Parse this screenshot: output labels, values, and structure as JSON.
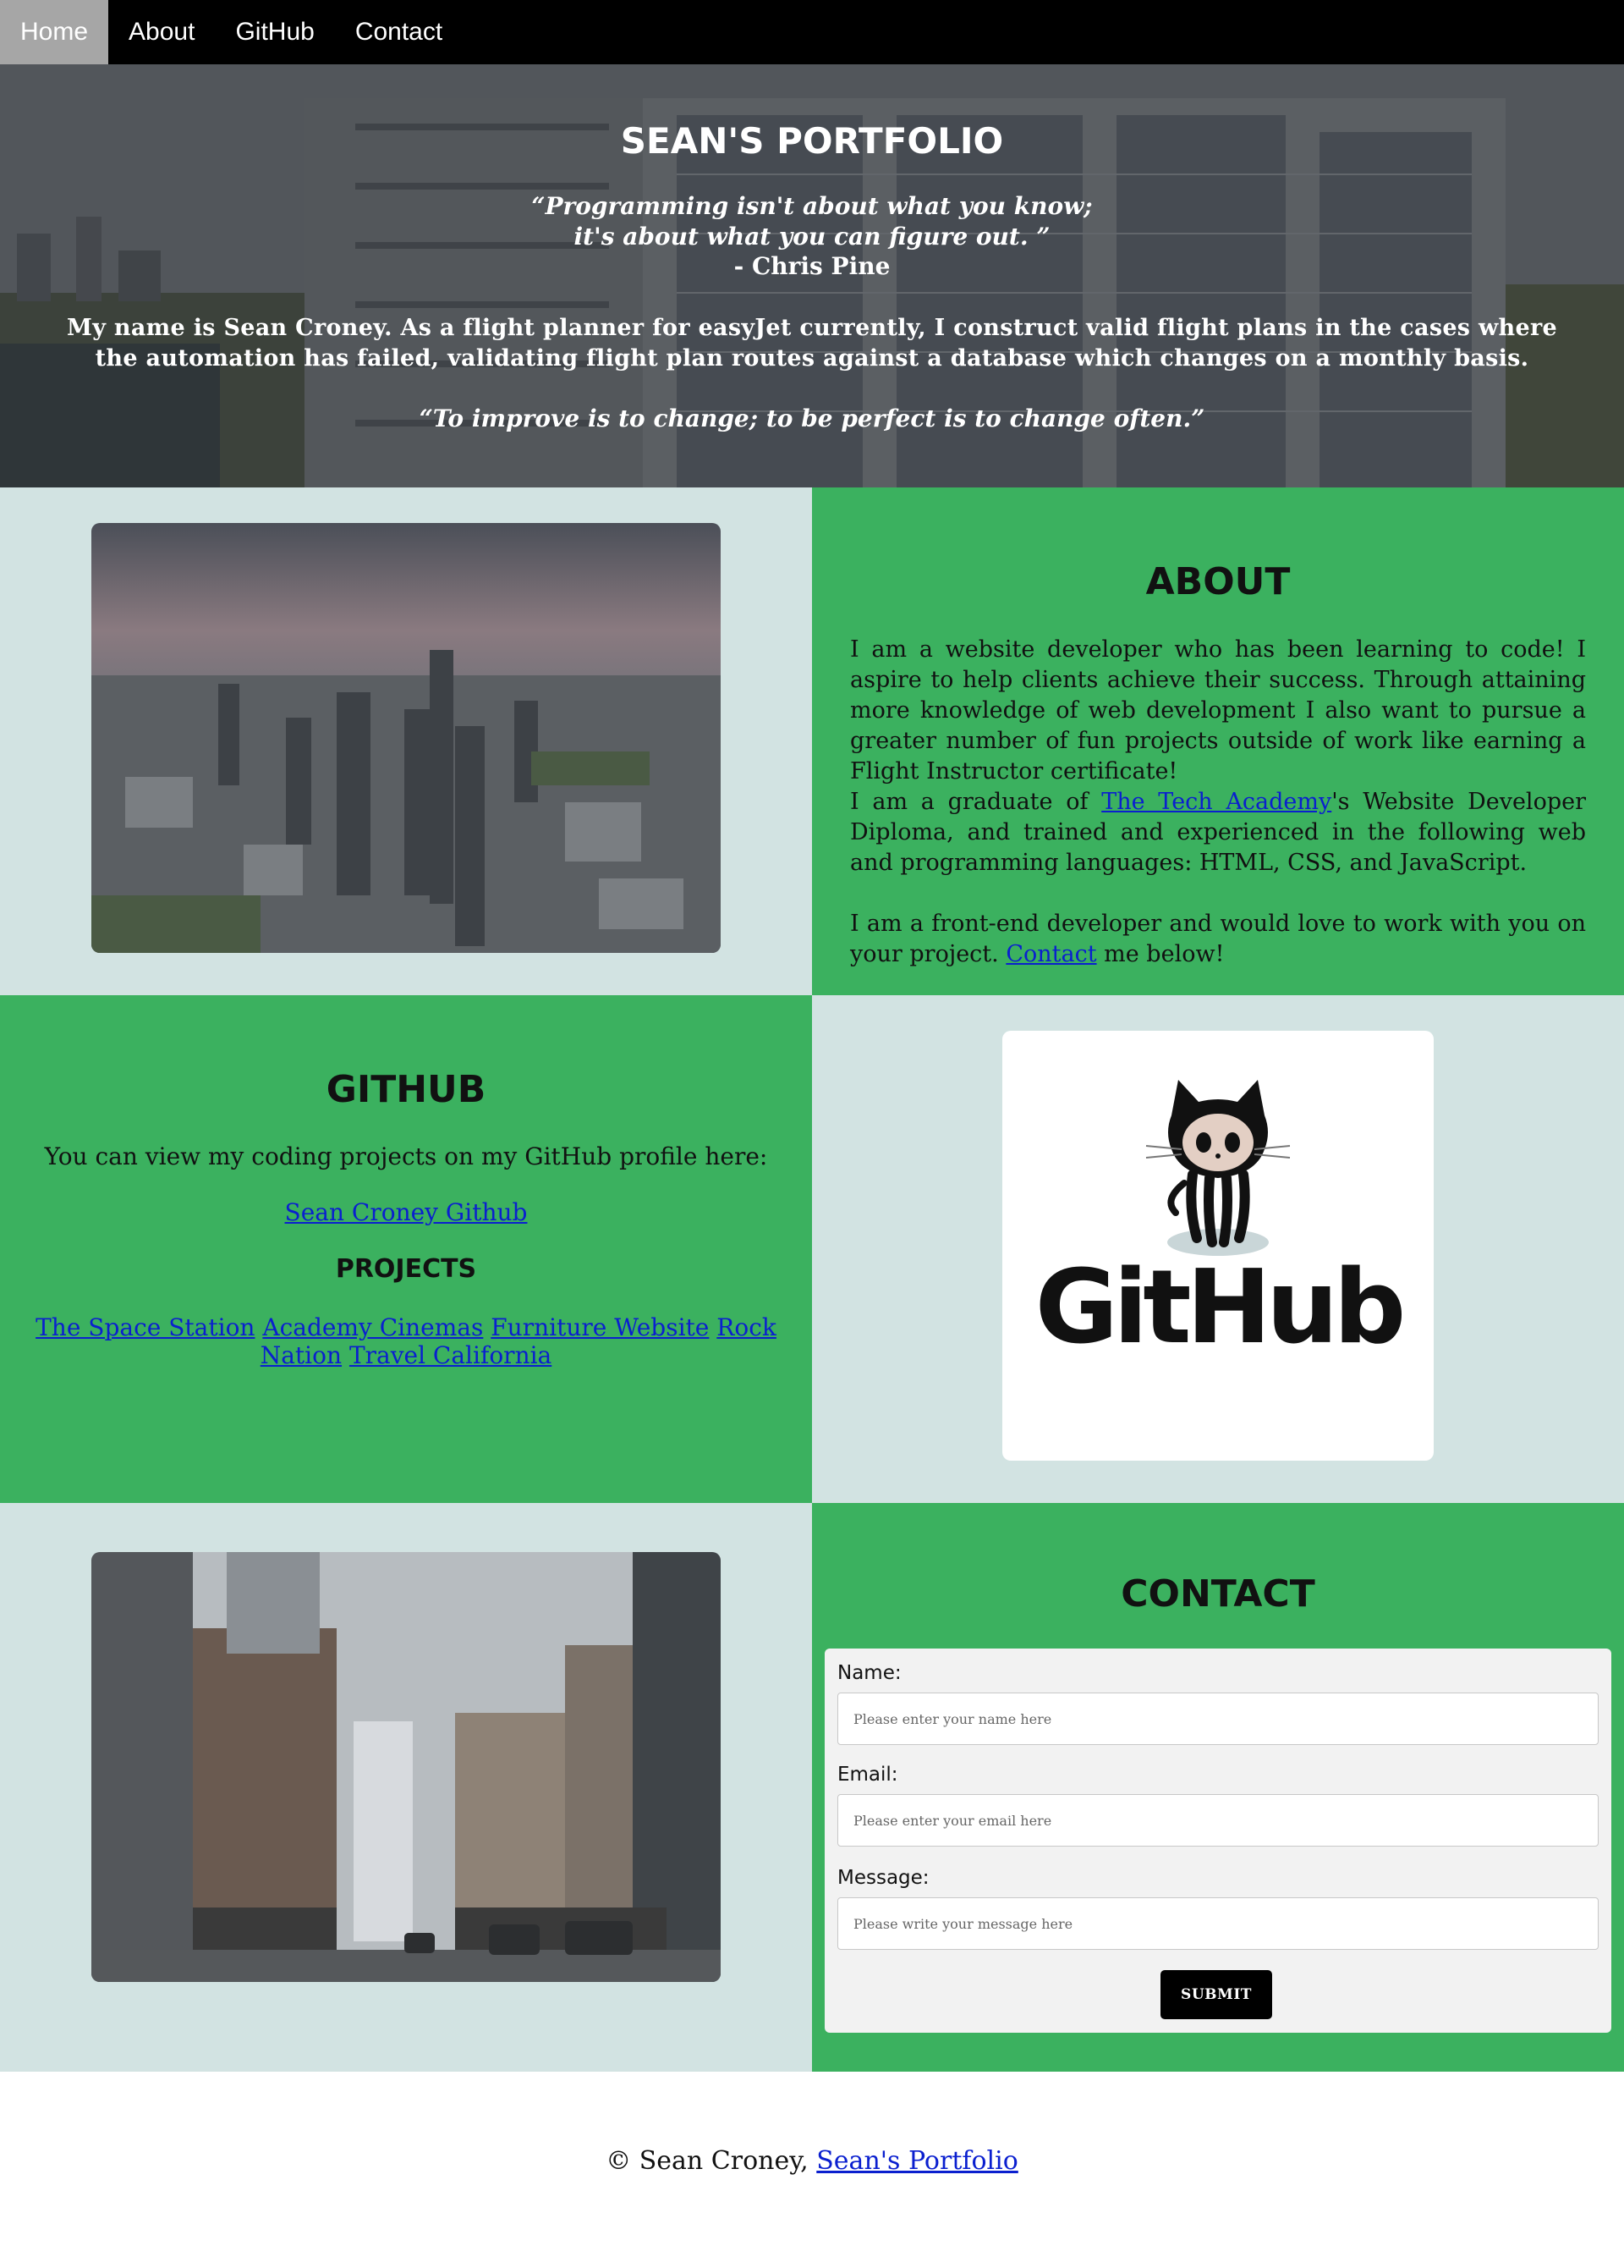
{
  "nav": {
    "items": [
      {
        "label": "Home"
      },
      {
        "label": "About"
      },
      {
        "label": "GitHub"
      },
      {
        "label": "Contact"
      }
    ]
  },
  "hero": {
    "title": "SEAN'S PORTFOLIO",
    "quote_line1": "“Programming isn't about what you know;",
    "quote_line2": "it's about what you can figure out. ”",
    "author": "- Chris Pine",
    "bio": "My name is Sean Croney. As a flight planner for easyJet currently, I construct valid flight plans in the cases where the automation has failed, validating flight plan routes against a database which changes on a monthly basis.",
    "quote2": "“To improve is to change; to be perfect is to change often.”"
  },
  "about": {
    "heading": "ABOUT",
    "p1": "I am a website developer who has been learning to code! I aspire to help clients achieve their success. Through attaining more knowledge of web development I also want to pursue a greater number of fun projects outside of work like earning a Flight Instructor certificate!",
    "p2_before": "I am a graduate of ",
    "p2_link": "The Tech Academy",
    "p2_after": "'s Website Developer Diploma, and trained and experienced in the following web and programming languages: HTML, CSS, and JavaScript.",
    "p3_before": "I am a front-end developer and would love to work with you on your project. ",
    "p3_link": "Contact",
    "p3_after": " me below!"
  },
  "github": {
    "heading": "GITHUB",
    "intro": "You can view my coding projects on my GitHub profile here:",
    "profile_link": "Sean Croney Github",
    "projects_heading": "PROJECTS",
    "projects": [
      {
        "label": "The Space Station"
      },
      {
        "label": "Academy Cinemas"
      },
      {
        "label": "Furniture Website"
      },
      {
        "label": "Rock Nation"
      },
      {
        "label": "Travel California"
      }
    ],
    "logo_text": "GitHub"
  },
  "contact": {
    "heading": "CONTACT",
    "name_label": "Name:",
    "name_placeholder": "Please enter your name here",
    "email_label": "Email:",
    "email_placeholder": "Please enter your email here",
    "message_label": "Message:",
    "message_placeholder": "Please write your message here",
    "submit_label": "SUBMIT"
  },
  "footer": {
    "text": "© Sean Croney, ",
    "link": "Sean's Portfolio"
  },
  "colors": {
    "green": "#3bb15f",
    "light": "#d2e3e2",
    "nav_bg": "#000000",
    "nav_active": "#a6a6a6",
    "link": "#0a1fcf"
  }
}
